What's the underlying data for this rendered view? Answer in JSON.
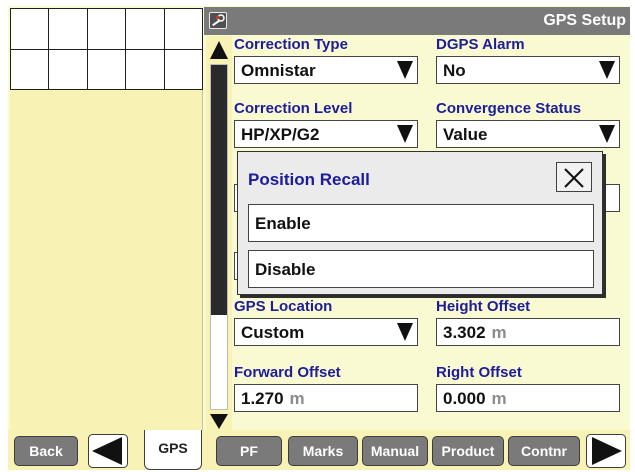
{
  "window": {
    "title": "GPS Setup",
    "icon": "wrench-icon"
  },
  "fields": {
    "correction_type": {
      "label": "Correction Type",
      "value": "Omnistar"
    },
    "dgps_alarm": {
      "label": "DGPS Alarm",
      "value": "No"
    },
    "correction_level": {
      "label": "Correction Level",
      "value": "HP/XP/G2"
    },
    "convergence_status": {
      "label": "Convergence Status",
      "value": "Value"
    },
    "gps_location": {
      "label": "GPS Location",
      "value": "Custom"
    },
    "height_offset": {
      "label": "Height Offset",
      "value": "3.302",
      "unit": "m"
    },
    "forward_offset": {
      "label": "Forward Offset",
      "value": "1.270",
      "unit": "m"
    },
    "right_offset": {
      "label": "Right Offset",
      "value": "0.000",
      "unit": "m"
    }
  },
  "modal": {
    "title": "Position Recall",
    "close_icon": "close-icon",
    "options": [
      "Enable",
      "Disable"
    ]
  },
  "bottom_bar": {
    "back": "Back",
    "gps_tab": "GPS",
    "buttons": [
      "PF",
      "Marks",
      "Manual",
      "Product",
      "Contnr"
    ]
  },
  "colors": {
    "panel_background": "#fafad2",
    "label_text": "#1c1c9c",
    "title_bar": "#7a7a7a",
    "button": "#7a7a7a"
  }
}
